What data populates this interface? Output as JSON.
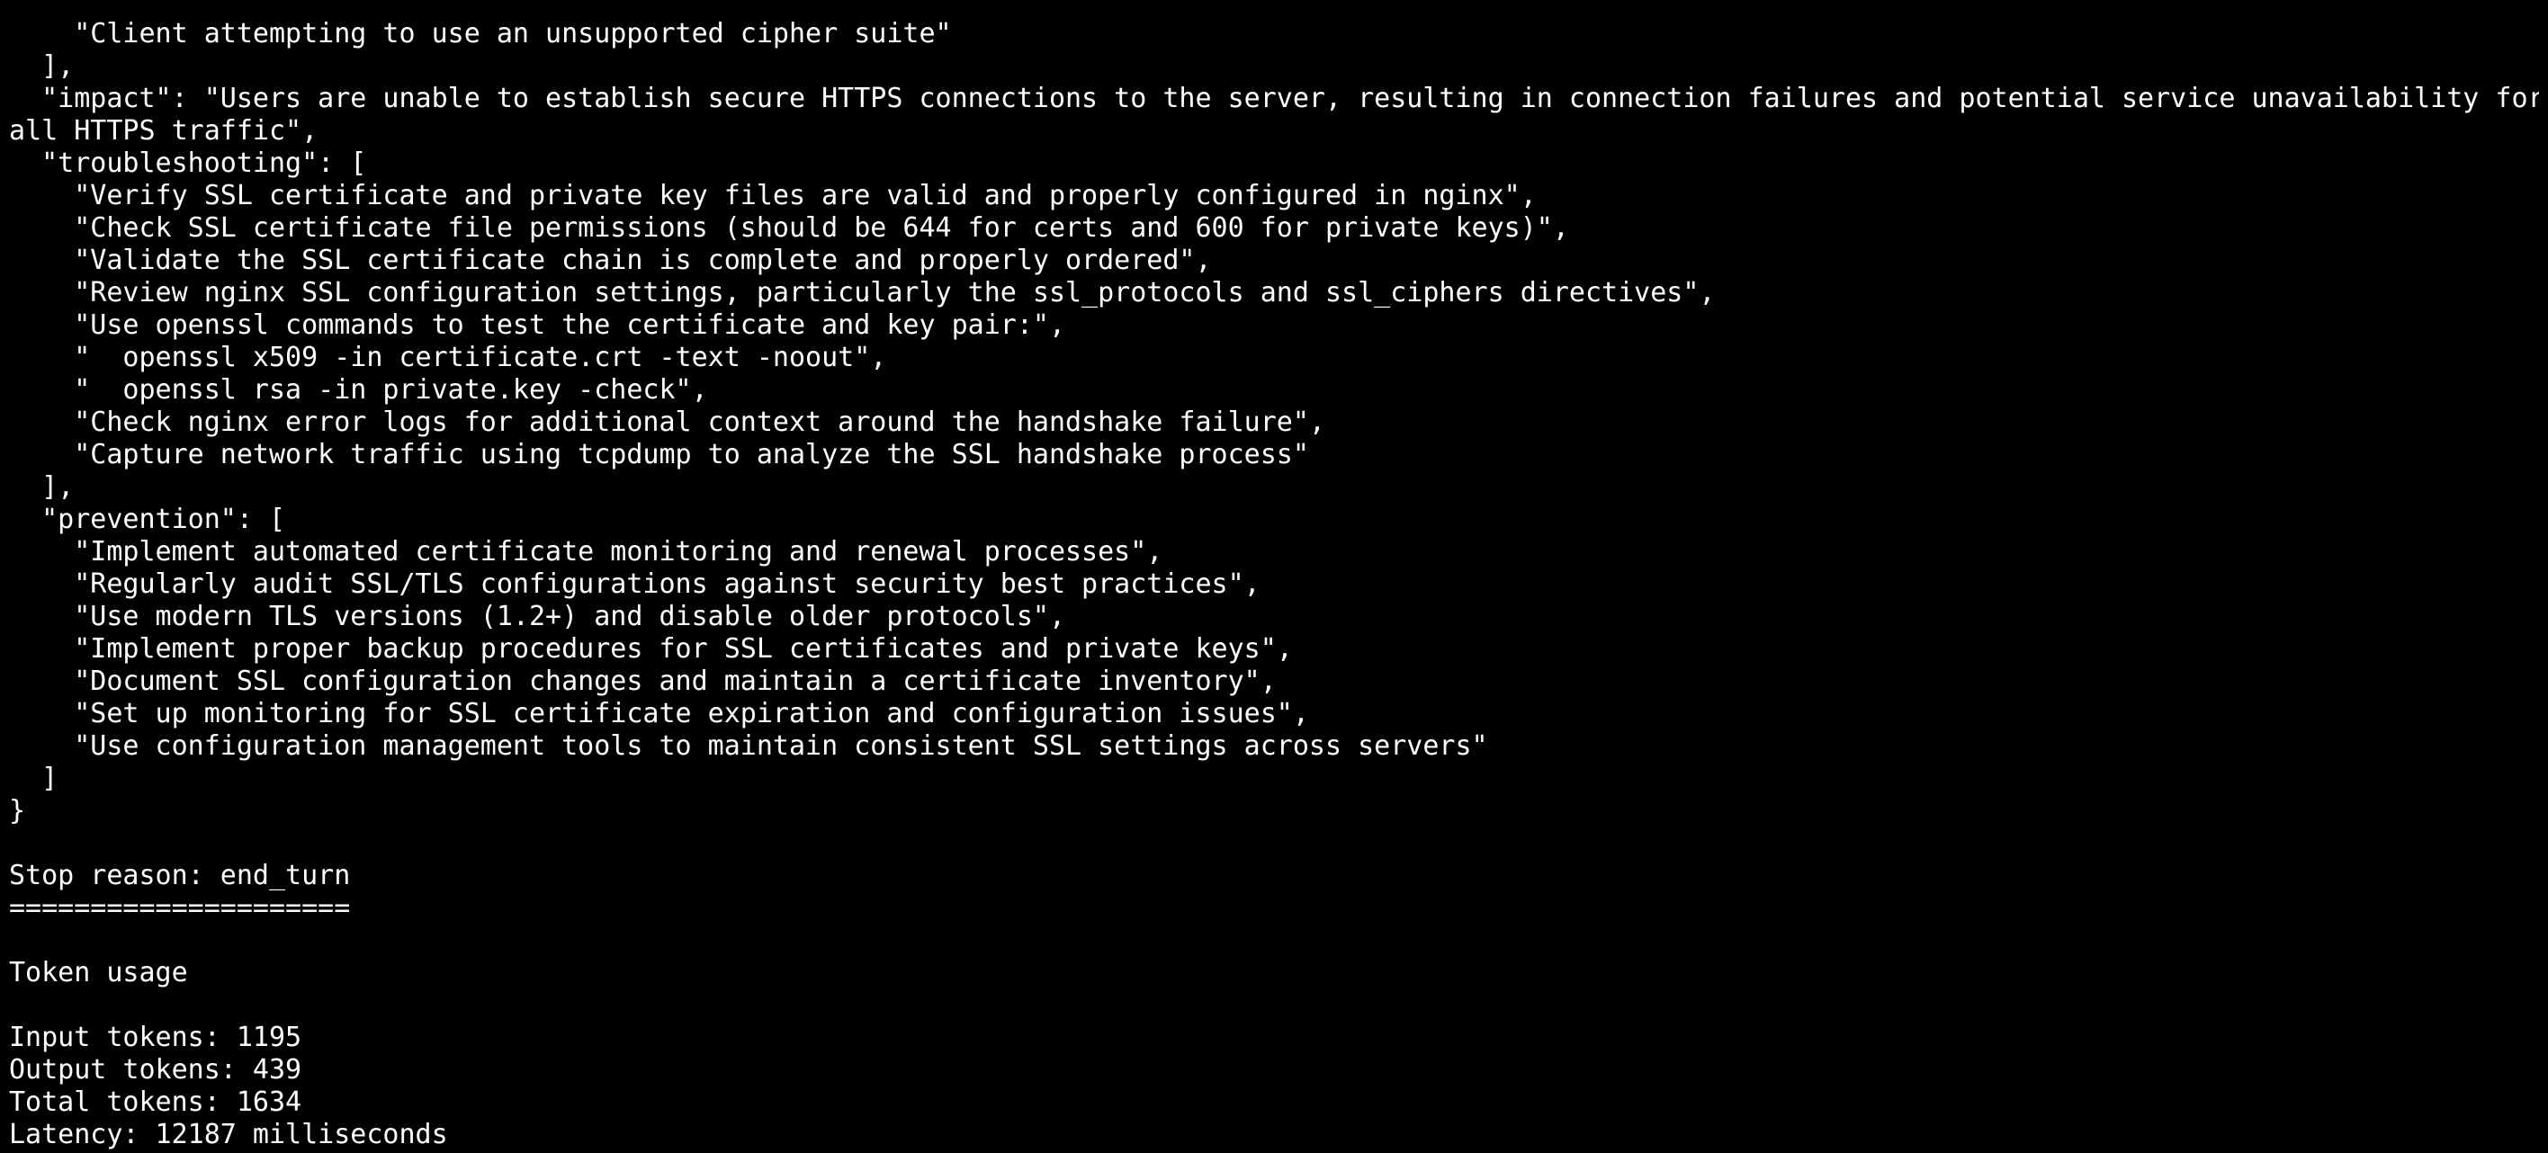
{
  "terminal": {
    "background": "#000000",
    "foreground": "#ffffff",
    "lines": [
      "    \"Client attempting to use an unsupported cipher suite\"",
      "  ],",
      "  \"impact\": \"Users are unable to establish secure HTTPS connections to the server, resulting in connection failures and potential service unavailability for",
      "all HTTPS traffic\",",
      "  \"troubleshooting\": [",
      "    \"Verify SSL certificate and private key files are valid and properly configured in nginx\",",
      "    \"Check SSL certificate file permissions (should be 644 for certs and 600 for private keys)\",",
      "    \"Validate the SSL certificate chain is complete and properly ordered\",",
      "    \"Review nginx SSL configuration settings, particularly the ssl_protocols and ssl_ciphers directives\",",
      "    \"Use openssl commands to test the certificate and key pair:\",",
      "    \"  openssl x509 -in certificate.crt -text -noout\",",
      "    \"  openssl rsa -in private.key -check\",",
      "    \"Check nginx error logs for additional context around the handshake failure\",",
      "    \"Capture network traffic using tcpdump to analyze the SSL handshake process\"",
      "  ],",
      "  \"prevention\": [",
      "    \"Implement automated certificate monitoring and renewal processes\",",
      "    \"Regularly audit SSL/TLS configurations against security best practices\",",
      "    \"Use modern TLS versions (1.2+) and disable older protocols\",",
      "    \"Implement proper backup procedures for SSL certificates and private keys\",",
      "    \"Document SSL configuration changes and maintain a certificate inventory\",",
      "    \"Set up monitoring for SSL certificate expiration and configuration issues\",",
      "    \"Use configuration management tools to maintain consistent SSL settings across servers\"",
      "  ]",
      "}",
      "",
      "Stop reason: end_turn",
      "=====================",
      "",
      "Token usage",
      "",
      "Input tokens: 1195",
      "Output tokens: 439",
      "Total tokens: 1634",
      "Latency: 12187 milliseconds"
    ]
  }
}
